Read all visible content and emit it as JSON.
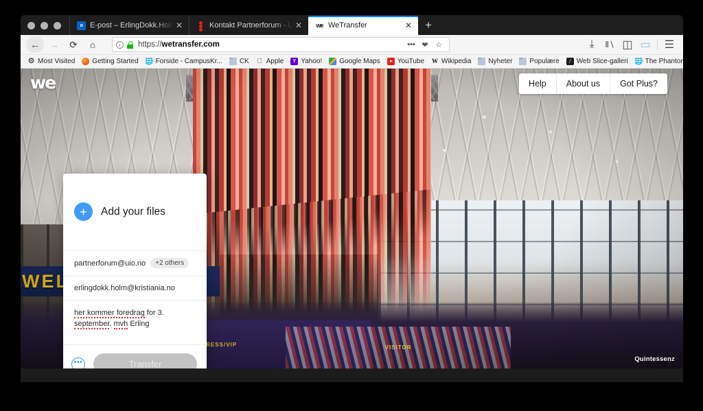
{
  "browser": {
    "traffic_lights": [
      "close",
      "minimize",
      "maximize"
    ],
    "tabs": [
      {
        "title": "E-post – ErlingDokk.Holm@kri",
        "favicon": "outlook-icon",
        "active": false,
        "close_label": "✕"
      },
      {
        "title": "Kontakt Partnerforum - Univers",
        "favicon": "uio-icon",
        "active": false,
        "close_label": "✕"
      },
      {
        "title": "WeTransfer",
        "favicon": "wetransfer-icon",
        "active": true,
        "close_label": "✕"
      }
    ],
    "new_tab_label": "+",
    "nav": {
      "back": "←",
      "forward": "→",
      "reload": "⟳",
      "home": "⌂"
    },
    "urlbar": {
      "scheme": "https://",
      "host": "wetransfer.com",
      "full_url": "https://wetransfer.com",
      "identity_info": "i",
      "page_actions": "•••",
      "pocket": "❤",
      "bookmark_star": "☆"
    },
    "toolbar_right": {
      "downloads": "⤓",
      "library": "Ⅱ∖",
      "sidebar": "◫",
      "container_tab": "▭",
      "menu": "☰"
    },
    "bookmarks": [
      {
        "label": "Most Visited",
        "icon": "gear-icon"
      },
      {
        "label": "Getting Started",
        "icon": "firefox-icon"
      },
      {
        "label": "Forside - CampusKr...",
        "icon": "globe-icon"
      },
      {
        "label": "CK",
        "icon": "folder-icon"
      },
      {
        "label": "Apple",
        "icon": "apple-icon"
      },
      {
        "label": "Yahoo!",
        "icon": "yahoo-icon"
      },
      {
        "label": "Google Maps",
        "icon": "google-maps-icon"
      },
      {
        "label": "YouTube",
        "icon": "youtube-icon"
      },
      {
        "label": "Wikipedia",
        "icon": "wikipedia-icon"
      },
      {
        "label": "Nyheter",
        "icon": "folder-icon"
      },
      {
        "label": "Populære",
        "icon": "folder-icon"
      },
      {
        "label": "Web Slice-galleri",
        "icon": "web-slice-icon"
      },
      {
        "label": "The Phantom of the...",
        "icon": "globe-icon"
      }
    ],
    "bookmarks_overflow": "»"
  },
  "site": {
    "logo_text": "we",
    "nav_items": [
      {
        "label": "Help"
      },
      {
        "label": "About us"
      },
      {
        "label": "Got Plus?"
      }
    ],
    "watermark": "Quintessenz",
    "background": {
      "welcome_sign": "WELCOME",
      "press_vip_sign": "PRESS/VIP",
      "visitor_sign": "VISITOR"
    }
  },
  "transfer_card": {
    "add_files": {
      "plus": "+",
      "label": "Add your files"
    },
    "recipient_email": "partnerforum@uio.no",
    "recipient_extra": "+2 others",
    "sender_email": "erlingdokk.holm@kristiania.no",
    "message_line1": "her kommer foredrag",
    "message_line1_tail": " for 3.",
    "message_line2a": "september",
    "message_line2b": ". ",
    "message_line2c": "mvh",
    "message_line2d": " Erling",
    "message_full": "her kommer foredrag for 3. september. mvh Erling",
    "more_options": "•••",
    "transfer_button": "Transfer"
  },
  "colors": {
    "accent_blue": "#3f9bf7",
    "tab_highlight": "#0a84ff",
    "lock_green": "#12bc00",
    "transfer_disabled": "#c2c2c2"
  }
}
